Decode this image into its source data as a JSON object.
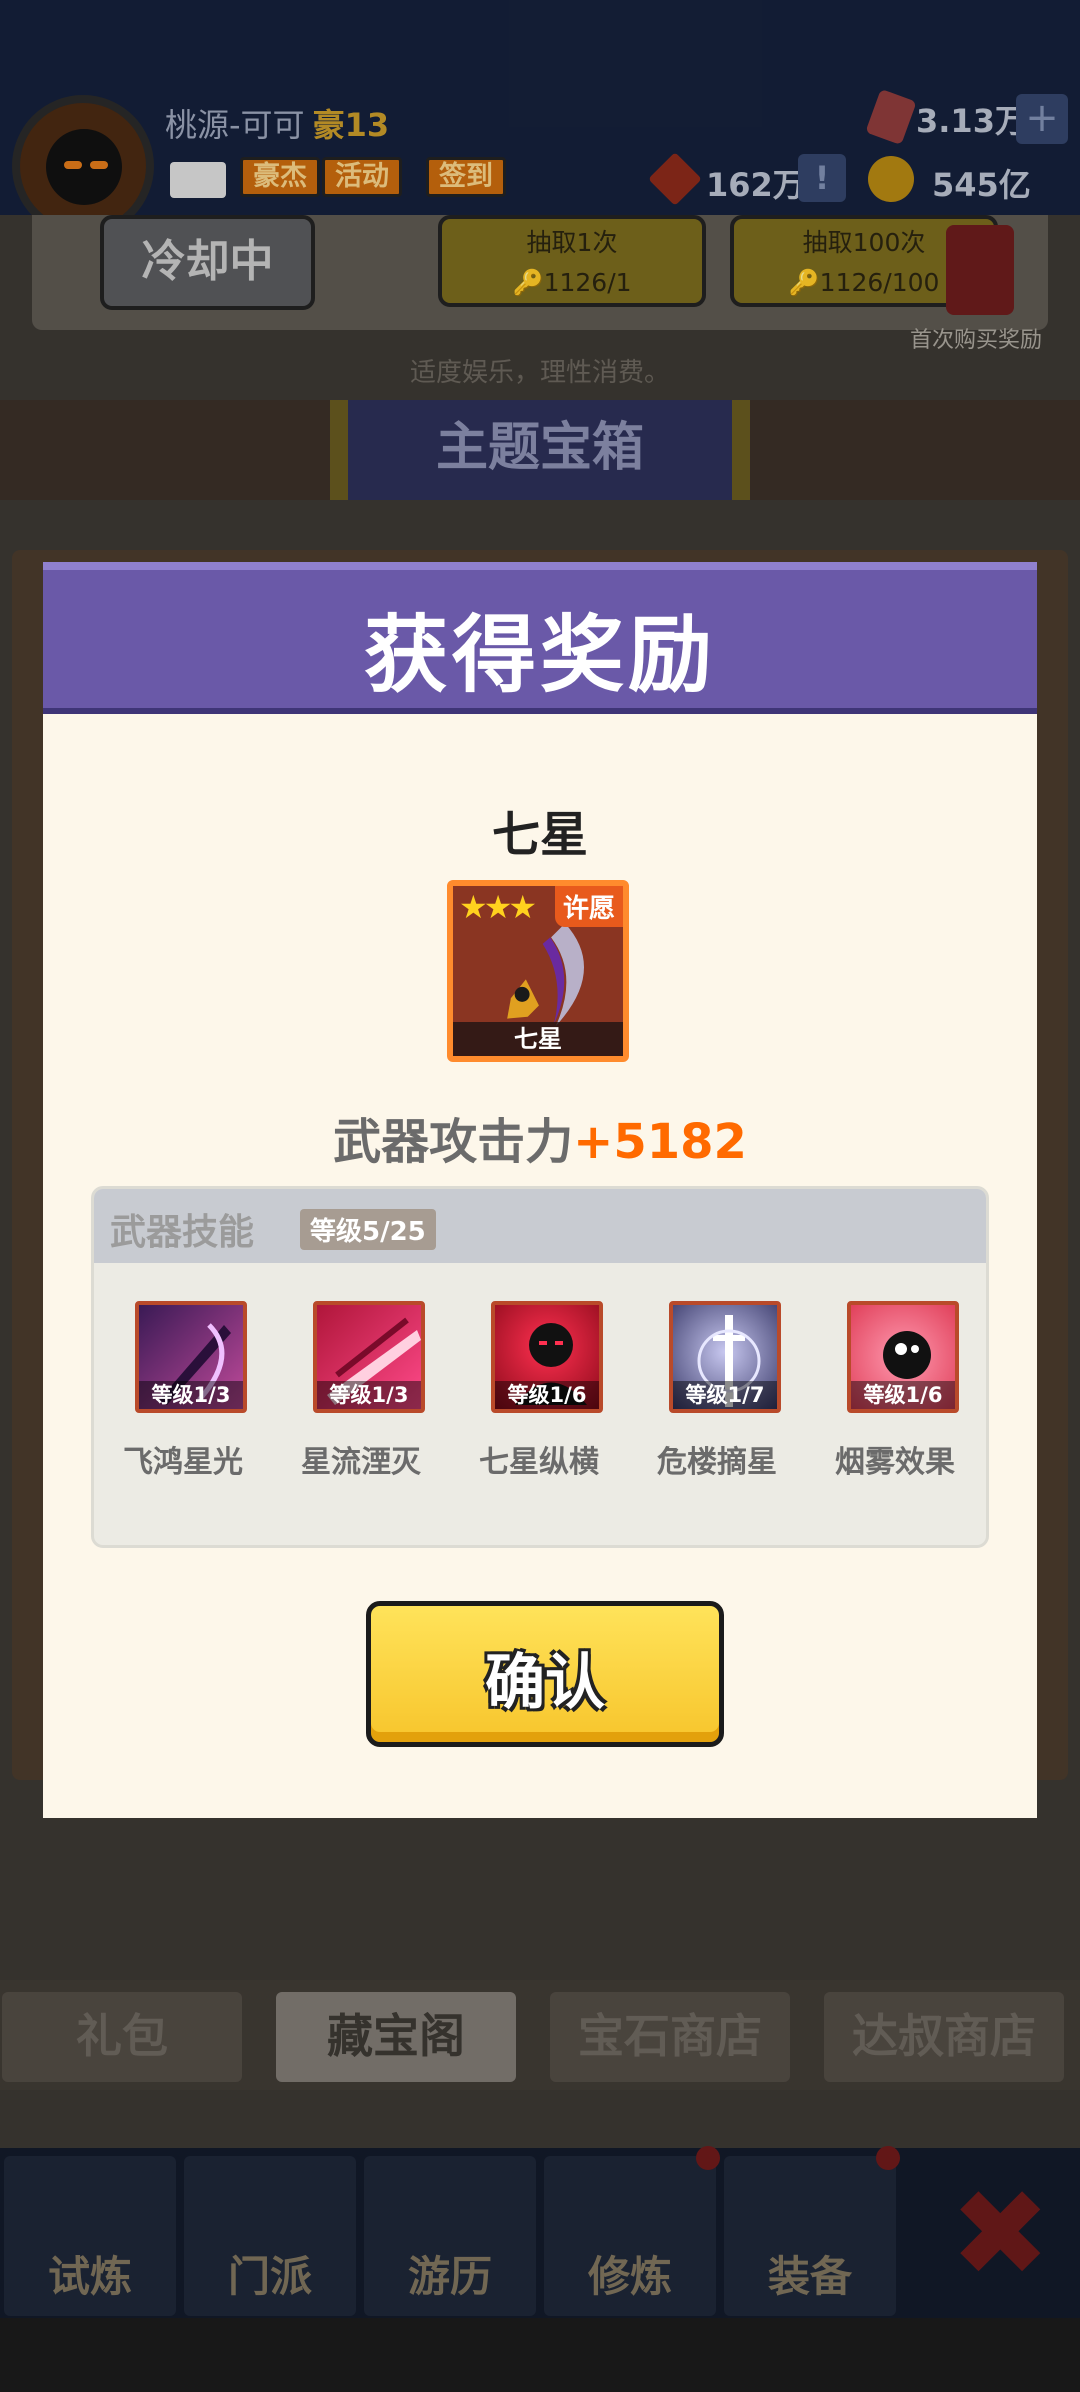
{
  "player": {
    "name": "桃源-可可",
    "rank": "豪13"
  },
  "resources": {
    "gems": "3.13万",
    "tokens": "162万",
    "coins": "545亿"
  },
  "top_buttons": {
    "hero": "豪杰",
    "event": "活动",
    "checkin": "签到"
  },
  "shop": {
    "cooldown_label": "冷却中",
    "draw_once_label": "抽取1次",
    "draw_once_cost": "🔑1126/1",
    "draw_hundred_label": "抽取100次",
    "draw_hundred_cost": "🔑1126/100",
    "first_purchase_label": "首次购买奖励",
    "hint": "适度娱乐，理性消费。"
  },
  "theme_banner": "主题宝箱",
  "modal": {
    "title": "获得奖励",
    "reward_name": "七星",
    "card": {
      "stars": "★★★",
      "badge": "许愿",
      "label": "七星"
    },
    "attack_label": "武器攻击力",
    "attack_value": "+5182",
    "skills_title": "武器技能",
    "skills_level": "等级5/25",
    "skills": [
      {
        "name": "飞鸿星光",
        "level": "等级1/3",
        "icon": "purple-blade-icon"
      },
      {
        "name": "星流湮灭",
        "level": "等级1/3",
        "icon": "red-slash-icon"
      },
      {
        "name": "七星纵横",
        "level": "等级1/6",
        "icon": "shadow-figure-icon"
      },
      {
        "name": "危楼摘星",
        "level": "等级1/7",
        "icon": "light-sword-icon"
      },
      {
        "name": "烟雾效果",
        "level": "等级1/6",
        "icon": "smoke-face-icon"
      }
    ],
    "confirm_label": "确认"
  },
  "tabs": [
    "礼包",
    "藏宝阁",
    "宝石商店",
    "达叔商店"
  ],
  "nav": [
    "试炼",
    "门派",
    "游历",
    "修炼",
    "装备"
  ]
}
